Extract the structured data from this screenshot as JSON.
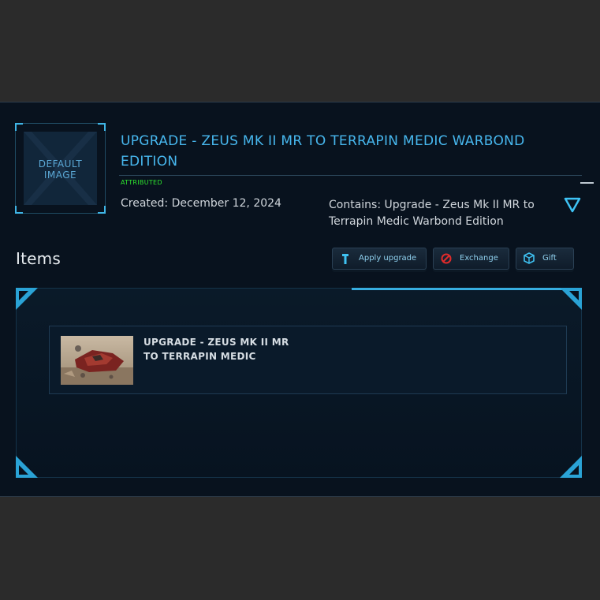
{
  "pledge": {
    "thumbnail_text_line1": "DEFAULT",
    "thumbnail_text_line2": "IMAGE",
    "title": "UPGRADE - ZEUS MK II MR TO TERRAPIN MEDIC WARBOND EDITION",
    "status": "ATTRIBUTED",
    "created": "Created: December 12, 2024",
    "contains": "Contains: Upgrade - Zeus Mk II MR to Terrapin Medic Warbond Edition"
  },
  "items_section": {
    "heading": "Items",
    "buttons": [
      {
        "label": "Apply upgrade",
        "icon": "upgrade-arrow-icon"
      },
      {
        "label": "Exchange",
        "icon": "exchange-circle-icon"
      },
      {
        "label": "Gift",
        "icon": "gift-cube-icon"
      }
    ],
    "items": [
      {
        "name": "UPGRADE - ZEUS MK II MR TO TERRAPIN MEDIC",
        "thumbnail": "ship-thumbnail"
      }
    ]
  },
  "colors": {
    "accent": "#47b7ee",
    "status_green": "#2ee62e",
    "panel_bg": "#08121e",
    "page_bg": "#2b2b2b"
  }
}
